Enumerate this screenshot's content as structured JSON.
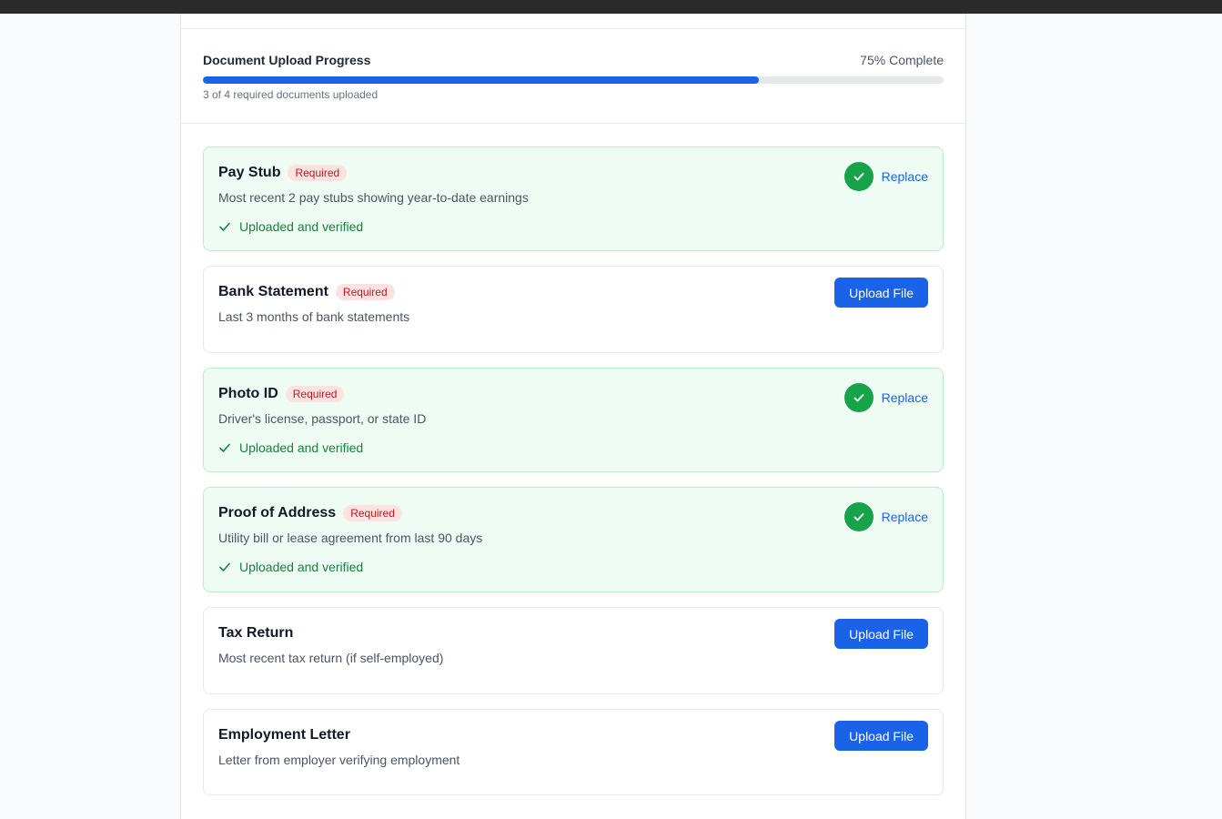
{
  "progress": {
    "title": "Document Upload Progress",
    "percent_label": "75% Complete",
    "percent": 75,
    "subtitle": "3 of 4 required documents uploaded"
  },
  "documents": [
    {
      "name": "Pay Stub",
      "badge": "Required",
      "description": "Most recent 2 pay stubs showing year-to-date earnings",
      "status": "Uploaded and verified",
      "action": "Replace",
      "uploaded": true
    },
    {
      "name": "Bank Statement",
      "badge": "Required",
      "description": "Last 3 months of bank statements",
      "action": "Upload File",
      "uploaded": false
    },
    {
      "name": "Photo ID",
      "badge": "Required",
      "description": "Driver's license, passport, or state ID",
      "status": "Uploaded and verified",
      "action": "Replace",
      "uploaded": true
    },
    {
      "name": "Proof of Address",
      "badge": "Required",
      "description": "Utility bill or lease agreement from last 90 days",
      "status": "Uploaded and verified",
      "action": "Replace",
      "uploaded": true
    },
    {
      "name": "Tax Return",
      "description": "Most recent tax return (if self-employed)",
      "action": "Upload File",
      "uploaded": false
    },
    {
      "name": "Employment Letter",
      "description": "Letter from employer verifying employment",
      "action": "Upload File",
      "uploaded": false
    }
  ],
  "colors": {
    "accent": "#1a63e6",
    "success": "#16a34a",
    "success_bg": "#effcf3",
    "required_badge_bg": "#fde2e2",
    "required_badge_text": "#b91c1c"
  },
  "icons": {
    "verified": "check-circle-icon",
    "status": "check-icon"
  }
}
